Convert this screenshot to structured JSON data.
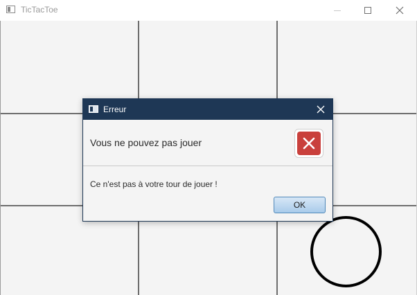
{
  "window": {
    "title": "TicTacToe",
    "icon": "app-window-icon"
  },
  "board": {
    "grid": "3x3",
    "marks": [
      {
        "row": 3,
        "col": 3,
        "symbol": "O"
      }
    ]
  },
  "dialog": {
    "title": "Erreur",
    "header": "Vous ne pouvez pas jouer",
    "content": "Ce n'est pas à votre tour de jouer !",
    "ok_label": "OK",
    "icon": "error-icon",
    "colors": {
      "titlebar": "#1e3755",
      "error": "#c9403c"
    }
  }
}
